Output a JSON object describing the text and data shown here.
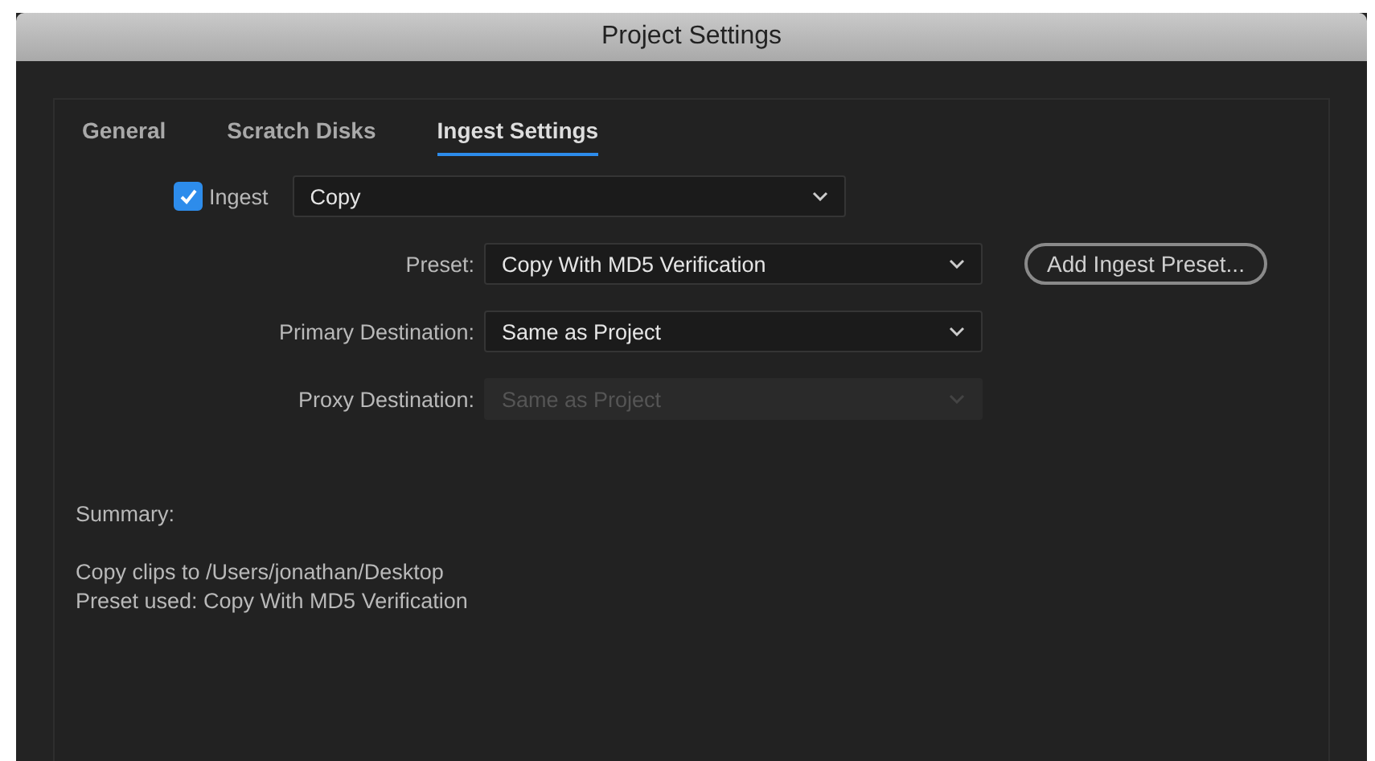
{
  "window": {
    "title": "Project Settings"
  },
  "tabs": [
    {
      "label": "General",
      "selected": false
    },
    {
      "label": "Scratch Disks",
      "selected": false
    },
    {
      "label": "Ingest Settings",
      "selected": true
    }
  ],
  "ingest": {
    "label": "Ingest",
    "checked": true,
    "value": "Copy"
  },
  "fields": [
    {
      "label": "Preset:",
      "value": "Copy With MD5 Verification",
      "disabled": false,
      "button": "Add Ingest Preset..."
    },
    {
      "label": "Primary Destination:",
      "value": "Same as Project",
      "disabled": false
    },
    {
      "label": "Proxy Destination:",
      "value": "Same as Project",
      "disabled": true
    }
  ],
  "summary": {
    "heading": "Summary:",
    "lines": [
      "Copy clips to /Users/jonathan/Desktop",
      "Preset used: Copy With MD5 Verification"
    ]
  }
}
